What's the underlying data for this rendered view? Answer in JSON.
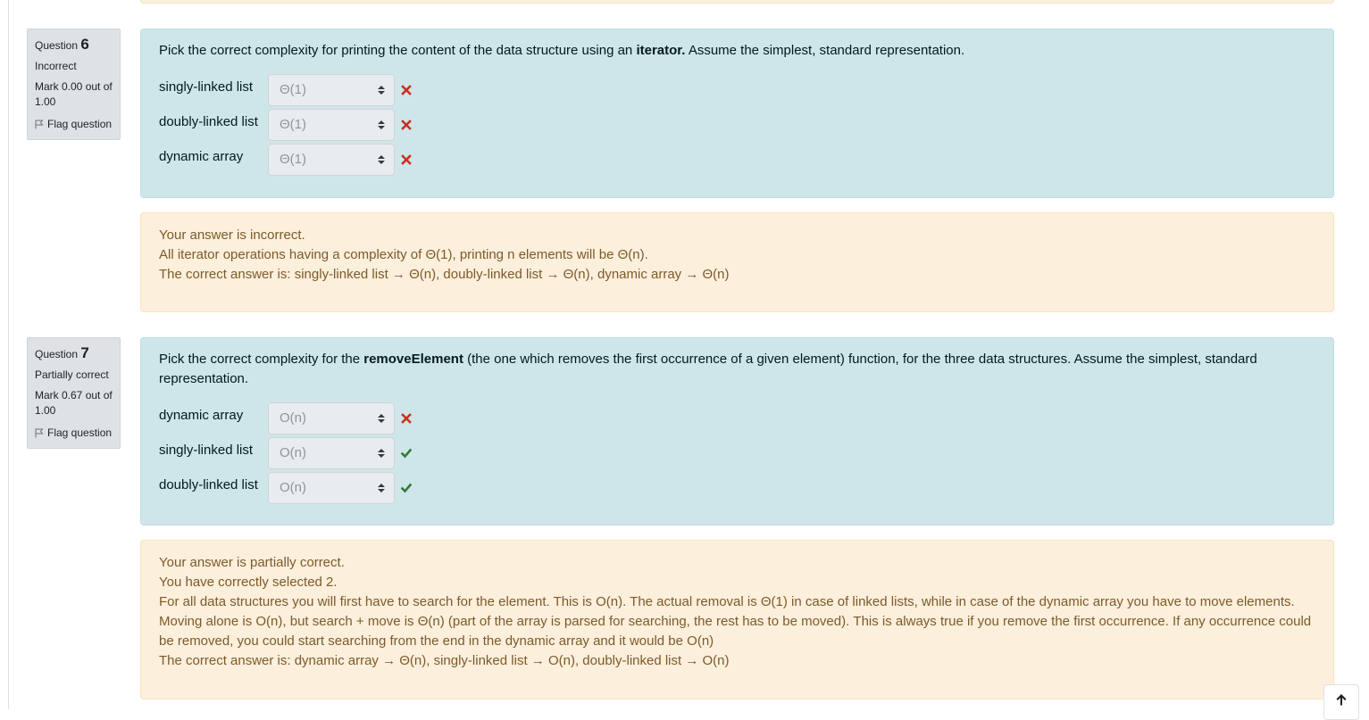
{
  "q6": {
    "label": "Question",
    "number": "6",
    "state": "Incorrect",
    "grade": "Mark 0.00 out of 1.00",
    "flag_label": "Flag question",
    "text_before": "Pick the correct complexity for printing the content of the data structure using an ",
    "text_bold": "iterator.",
    "text_after": "  Assume the simplest, standard representation.",
    "rows": [
      {
        "label": "singly-linked list",
        "value": "Θ(1)",
        "mark": "incorrect"
      },
      {
        "label": "doubly-linked list",
        "value": "Θ(1)",
        "mark": "incorrect"
      },
      {
        "label": "dynamic array",
        "value": "Θ(1)",
        "mark": "incorrect"
      }
    ],
    "feedback": {
      "summary": "Your answer is incorrect.",
      "general": "All iterator operations having a complexity of Θ(1), printing n elements will be Θ(n).",
      "right_answer": "The correct answer is: singly-linked list → Θ(n), doubly-linked list → Θ(n), dynamic array → Θ(n)"
    }
  },
  "q7": {
    "label": "Question",
    "number": "7",
    "state": "Partially correct",
    "grade": "Mark 0.67 out of 1.00",
    "flag_label": "Flag question",
    "text_before": "Pick the correct complexity for the ",
    "text_bold": "removeElement",
    "text_after": " (the one which removes the first occurrence of a given element) function, for the three data structures. Assume the simplest, standard representation.",
    "rows": [
      {
        "label": "dynamic array",
        "value": "O(n)",
        "mark": "incorrect"
      },
      {
        "label": "singly-linked list",
        "value": "O(n)",
        "mark": "correct"
      },
      {
        "label": "doubly-linked list",
        "value": "O(n)",
        "mark": "correct"
      }
    ],
    "feedback": {
      "summary": "Your answer is partially correct.",
      "num_correct": "You have correctly selected 2.",
      "general": "For all data structures you will first have to search for the element. This is O(n). The actual removal is Θ(1) in case of linked lists, while in case of the dynamic array you have to move elements. Moving alone is O(n), but search + move is Θ(n) (part of the array is parsed for searching, the rest has to be moved). This is always true if you remove the first occurrence. If any occurrence could be removed, you could start searching from the end in the dynamic array and it would be O(n)",
      "right_answer": "The correct answer is: dynamic array → Θ(n), singly-linked list → O(n), doubly-linked list → O(n)"
    }
  },
  "icons": {
    "flag": "flag-icon",
    "incorrect": "cross-icon",
    "correct": "check-icon",
    "select": "sort-updown-icon",
    "scroll_top": "arrow-up-icon"
  },
  "colors": {
    "formulation_bg": "#cee6ea",
    "feedback_bg": "#fcefdc",
    "incorrect": "#ca3120",
    "correct": "#357a32"
  }
}
